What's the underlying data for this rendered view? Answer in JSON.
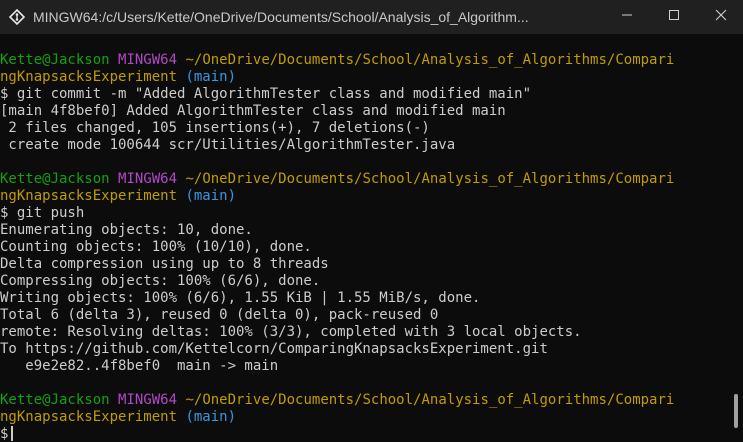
{
  "window": {
    "title": "MINGW64:/c/Users/Kette/OneDrive/Documents/School/Analysis_of_Algorithm...",
    "icon": "git-bash-icon",
    "controls": [
      "minimize-icon",
      "maximize-icon",
      "close-icon"
    ]
  },
  "colors": {
    "background": "#0c0c0c",
    "user_host": "#13a10e",
    "shell": "#b148c6",
    "path": "#c19c00",
    "branch": "#3a96dd",
    "text": "#cccccc"
  },
  "terminal": {
    "prompt1": {
      "user_host": "Kette@Jackson",
      "shell": "MINGW64",
      "path_part1": "~/OneDrive/Documents/School/Analysis_of_Algorithms/Compari",
      "path_part2": "ngKnapsacksExperiment",
      "branch": "(main)",
      "command": "$ git commit -m \"Added AlgorithmTester class and modified main\""
    },
    "commit_output": [
      "[main 4f8bef0] Added AlgorithmTester class and modified main",
      " 2 files changed, 105 insertions(+), 7 deletions(-)",
      " create mode 100644 scr/Utilities/AlgorithmTester.java"
    ],
    "prompt2": {
      "user_host": "Kette@Jackson",
      "shell": "MINGW64",
      "path_part1": "~/OneDrive/Documents/School/Analysis_of_Algorithms/Compari",
      "path_part2": "ngKnapsacksExperiment",
      "branch": "(main)",
      "command": "$ git push"
    },
    "push_output": [
      "Enumerating objects: 10, done.",
      "Counting objects: 100% (10/10), done.",
      "Delta compression using up to 8 threads",
      "Compressing objects: 100% (6/6), done.",
      "Writing objects: 100% (6/6), 1.55 KiB | 1.55 MiB/s, done.",
      "Total 6 (delta 3), reused 0 (delta 0), pack-reused 0",
      "remote: Resolving deltas: 100% (3/3), completed with 3 local objects.",
      "To https://github.com/Kettelcorn/ComparingKnapsacksExperiment.git",
      "   e9e2e82..4f8bef0  main -> main"
    ],
    "prompt3": {
      "user_host": "Kette@Jackson",
      "shell": "MINGW64",
      "path_part1": "~/OneDrive/Documents/School/Analysis_of_Algorithms/Compari",
      "path_part2": "ngKnapsacksExperiment",
      "branch": "(main)",
      "command": "$"
    }
  }
}
